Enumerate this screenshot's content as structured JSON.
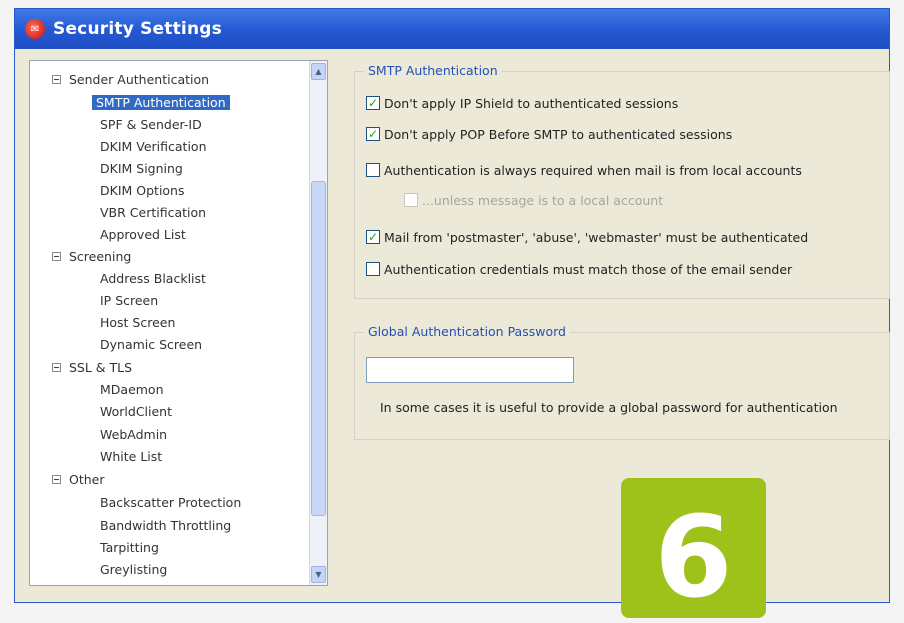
{
  "window": {
    "title": "Security Settings",
    "icon": "app-icon"
  },
  "tree": {
    "groups": [
      {
        "label": "Sender Authentication",
        "items": [
          "SMTP Authentication",
          "SPF & Sender-ID",
          "DKIM Verification",
          "DKIM Signing",
          "DKIM Options",
          "VBR Certification",
          "Approved List"
        ]
      },
      {
        "label": "Screening",
        "items": [
          "Address Blacklist",
          "IP Screen",
          "Host Screen",
          "Dynamic Screen"
        ]
      },
      {
        "label": "SSL & TLS",
        "items": [
          "MDaemon",
          "WorldClient",
          "WebAdmin",
          "White List"
        ]
      },
      {
        "label": "Other",
        "items": [
          "Backscatter Protection",
          "Bandwidth Throttling",
          "Tarpitting",
          "Greylisting"
        ]
      }
    ],
    "selected": "SMTP Authentication"
  },
  "smtp": {
    "group_label": "SMTP Authentication",
    "options": [
      {
        "label": "Don't apply IP Shield to authenticated sessions",
        "checked": true,
        "enabled": true
      },
      {
        "label": "Don't apply POP Before SMTP to authenticated sessions",
        "checked": true,
        "enabled": true
      },
      {
        "label": "Authentication is always required when mail is from local accounts",
        "checked": false,
        "enabled": true
      },
      {
        "label": "...unless message is to a local account",
        "checked": false,
        "enabled": false
      },
      {
        "label": "Mail from 'postmaster', 'abuse', 'webmaster' must be authenticated",
        "checked": true,
        "enabled": true
      },
      {
        "label": "Authentication credentials must match those of the email sender",
        "checked": false,
        "enabled": true
      }
    ]
  },
  "global_password": {
    "group_label": "Global Authentication Password",
    "value": "",
    "note": "In some cases it is useful to provide a global password for authentication"
  },
  "step_badge": {
    "number": "6",
    "color": "#9fc21b"
  },
  "colors": {
    "title_bar": "#2457d2",
    "selection": "#316ac5",
    "group_label": "#2250b6",
    "checkmark": "#21a121"
  }
}
